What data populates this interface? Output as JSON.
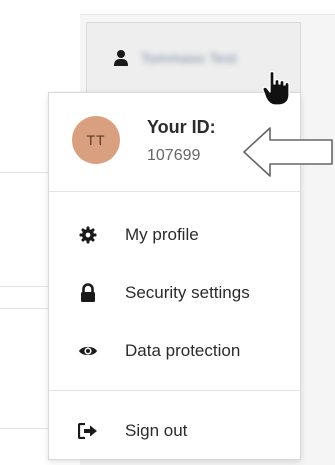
{
  "header": {
    "user_icon": "user-icon",
    "user_name": "Tommaso Test"
  },
  "dropdown": {
    "avatar_initials": "TT",
    "avatar_color": "#d9a080",
    "id_label": "Your ID:",
    "id_value": "107699",
    "menu": [
      {
        "label": "My profile",
        "icon": "gear-icon"
      },
      {
        "label": "Security settings",
        "icon": "lock-icon"
      },
      {
        "label": "Data protection",
        "icon": "eye-icon"
      },
      {
        "label": "Sign out",
        "icon": "sign-out-icon"
      }
    ]
  },
  "overlay": {
    "pointer": "hand-cursor-icon",
    "annotation": "left-arrow-icon"
  }
}
